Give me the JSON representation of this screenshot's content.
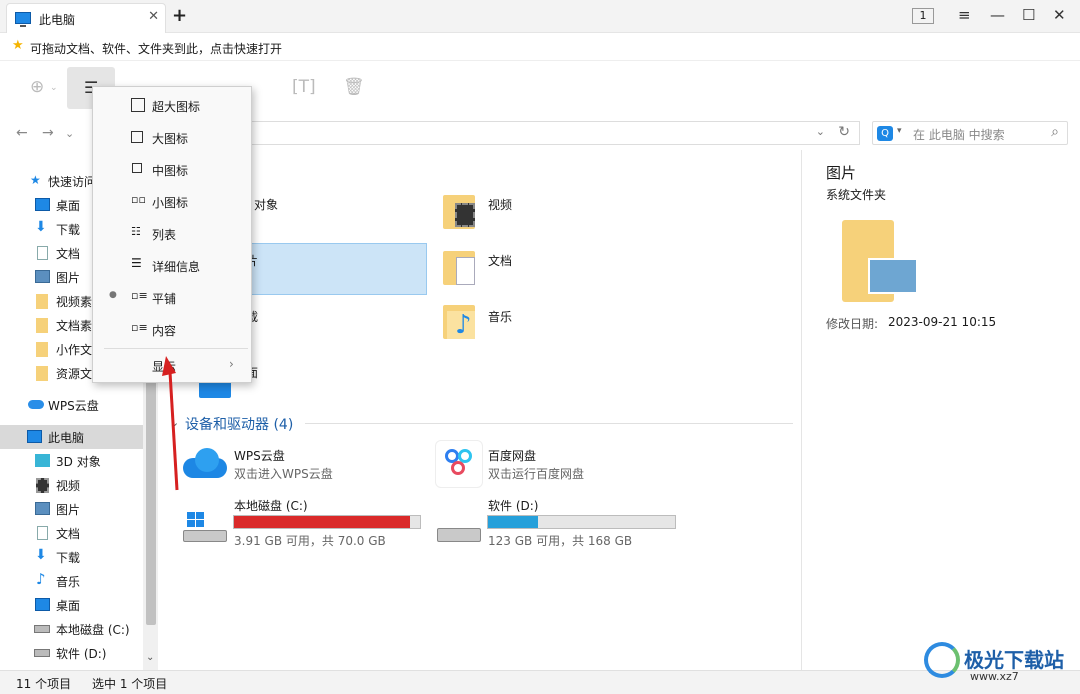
{
  "window": {
    "tab_title": "此电脑",
    "tab_close": "✕",
    "new_tab": "+",
    "window_count": "1",
    "menu_icon": "≡",
    "minimize": "—",
    "maximize": "☐",
    "close": "✕"
  },
  "quickbar": {
    "text": "可拖动文档、软件、文件夹到此，点击快速打开"
  },
  "search": {
    "placeholder": "在 此电脑 中搜索"
  },
  "nav": {
    "quick_access": "快速访问",
    "quick_items": [
      "桌面",
      "下载",
      "文档",
      "图片",
      "视频素",
      "文档素",
      "小作文",
      "资源文"
    ],
    "wps_cloud": "WPS云盘",
    "this_pc": "此电脑",
    "pc_items": [
      "3D 对象",
      "视频",
      "图片",
      "文档",
      "下载",
      "音乐",
      "桌面",
      "本地磁盘 (C:)",
      "软件 (D:)"
    ]
  },
  "main": {
    "folders": [
      {
        "label": "对象"
      },
      {
        "label": "视频"
      },
      {
        "label": "片"
      },
      {
        "label": "文档"
      },
      {
        "label": "载"
      },
      {
        "label": "音乐"
      },
      {
        "label": "面"
      }
    ],
    "section_title": "设备和驱动器 (4)",
    "drives": [
      {
        "name": "WPS云盘",
        "sub": "双击进入WPS云盘"
      },
      {
        "name": "百度网盘",
        "sub": "双击运行百度网盘"
      },
      {
        "name": "本地磁盘 (C:)",
        "sub": "3.91 GB 可用，共 70.0 GB",
        "used_fraction": 0.944,
        "color": "#da2a2a"
      },
      {
        "name": "软件 (D:)",
        "sub": "123 GB 可用，共 168 GB",
        "used_fraction": 0.268,
        "color": "#26a0da"
      }
    ]
  },
  "details": {
    "title": "图片",
    "subtitle": "系统文件夹",
    "modified_label": "修改日期:",
    "modified_value": "2023-09-21 10:15"
  },
  "view_menu": {
    "items": [
      "超大图标",
      "大图标",
      "中图标",
      "小图标",
      "列表",
      "详细信息",
      "平铺",
      "内容"
    ],
    "selected": "平铺",
    "show": "显示"
  },
  "status": {
    "count": "11 个项目",
    "selected": "选中 1 个项目"
  },
  "watermark": {
    "text": "极光下载站",
    "url": "www.xz7"
  }
}
